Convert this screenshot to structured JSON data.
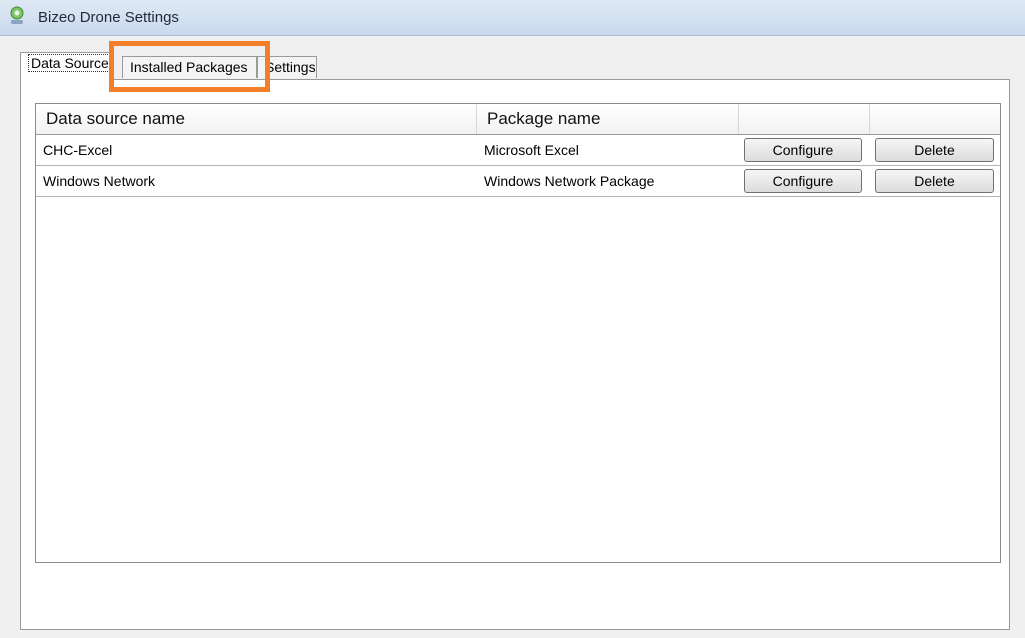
{
  "window": {
    "title": "Bizeo Drone Settings"
  },
  "tabs": [
    {
      "label": "Data Source",
      "active": true
    },
    {
      "label": "Installed Packages",
      "active": false
    },
    {
      "label": "Settings",
      "active": false
    }
  ],
  "grid": {
    "columns": [
      "Data source name",
      "Package name",
      "",
      ""
    ],
    "rows": [
      {
        "data_source": "CHC-Excel",
        "package": "Microsoft Excel",
        "configure_label": "Configure",
        "delete_label": "Delete"
      },
      {
        "data_source": "Windows Network",
        "package": "Windows Network Package",
        "configure_label": "Configure",
        "delete_label": "Delete"
      }
    ]
  },
  "colors": {
    "highlight": "#f37f2a",
    "titlebar": "#c9d9ec"
  },
  "icons": {
    "app": "app-icon"
  }
}
